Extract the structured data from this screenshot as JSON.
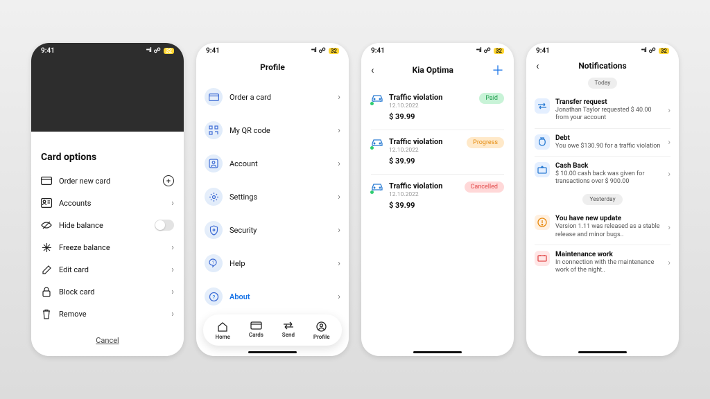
{
  "status": {
    "time": "9:41",
    "battery": "32"
  },
  "s1": {
    "title": "Card options",
    "items": [
      {
        "label": "Order new card"
      },
      {
        "label": "Accounts"
      },
      {
        "label": "Hide balance"
      },
      {
        "label": "Freeze balance"
      },
      {
        "label": "Edit card"
      },
      {
        "label": "Block card"
      },
      {
        "label": "Remove"
      }
    ],
    "cancel": "Cancel"
  },
  "s2": {
    "header": "Profile",
    "items": [
      {
        "label": "Order a card"
      },
      {
        "label": "My QR code"
      },
      {
        "label": "Account"
      },
      {
        "label": "Settings"
      },
      {
        "label": "Security"
      },
      {
        "label": "Help"
      },
      {
        "label": "About"
      }
    ],
    "tabs": {
      "home": "Home",
      "cards": "Cards",
      "send": "Send",
      "profile": "Profile"
    }
  },
  "s3": {
    "title": "Kia Optima",
    "items": [
      {
        "name": "Traffic violation",
        "date": "12.10.2022",
        "price": "$ 39.99",
        "status": "Paid"
      },
      {
        "name": "Traffic violation",
        "date": "12.10.2022",
        "price": "$ 39.99",
        "status": "Progress"
      },
      {
        "name": "Traffic violation",
        "date": "12.10.2022",
        "price": "$ 39.99",
        "status": "Cancelled"
      }
    ]
  },
  "s4": {
    "title": "Notifications",
    "today": "Today",
    "yesterday": "Yesterday",
    "today_items": [
      {
        "title": "Transfer request",
        "body": "Jonathan Taylor requested $ 40.00 from your account"
      },
      {
        "title": "Debt",
        "body": "You owe $130.90 for a traffic violation"
      },
      {
        "title": "Cash Back",
        "body": "$ 10.00 cash back was given for transactions over $ 900.00"
      }
    ],
    "yest_items": [
      {
        "title": "You have new update",
        "body": "Version 1.11 was released as a stable release and minor bugs.."
      },
      {
        "title": "Maintenance work",
        "body": "In connection with the maintenance work of the night.."
      }
    ]
  }
}
